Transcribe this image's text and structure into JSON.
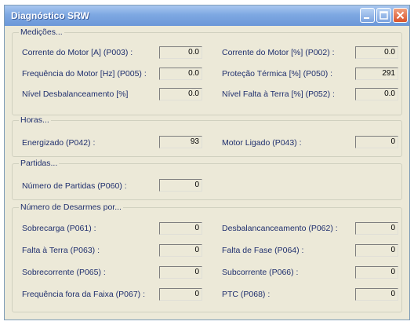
{
  "window": {
    "title": "Diagnóstico SRW"
  },
  "groups": {
    "medicoes": {
      "title": "Medições...",
      "items": [
        {
          "label": "Corrente do Motor [A] (P003) :",
          "value": "0.0"
        },
        {
          "label": "Corrente do Motor [%] (P002) :",
          "value": "0.0"
        },
        {
          "label": "Frequência do Motor [Hz] (P005) :",
          "value": "0.0"
        },
        {
          "label": "Proteção Térmica [%] (P050) :",
          "value": "291"
        },
        {
          "label": "Nível Desbalanceamento [%]",
          "value": "0.0"
        },
        {
          "label": "Nível Falta à Terra [%] (P052) :",
          "value": "0.0"
        }
      ]
    },
    "horas": {
      "title": "Horas...",
      "items": [
        {
          "label": "Energizado (P042) :",
          "value": "93"
        },
        {
          "label": "Motor Ligado (P043) :",
          "value": "0"
        }
      ]
    },
    "partidas": {
      "title": "Partidas...",
      "items": [
        {
          "label": "Número de Partidas (P060) :",
          "value": "0"
        }
      ]
    },
    "desarmes": {
      "title": "Número de Desarmes por...",
      "items": [
        {
          "label": "Sobrecarga (P061) :",
          "value": "0"
        },
        {
          "label": "Desbalancanceamento (P062) :",
          "value": "0"
        },
        {
          "label": "Falta à Terra (P063) :",
          "value": "0"
        },
        {
          "label": "Falta de Fase (P064) :",
          "value": "0"
        },
        {
          "label": "Sobrecorrente (P065) :",
          "value": "0"
        },
        {
          "label": "Subcorrente (P066) :",
          "value": "0"
        },
        {
          "label": "Frequência fora da Faixa (P067) :",
          "value": "0"
        },
        {
          "label": "PTC (P068) :",
          "value": "0"
        }
      ]
    }
  }
}
